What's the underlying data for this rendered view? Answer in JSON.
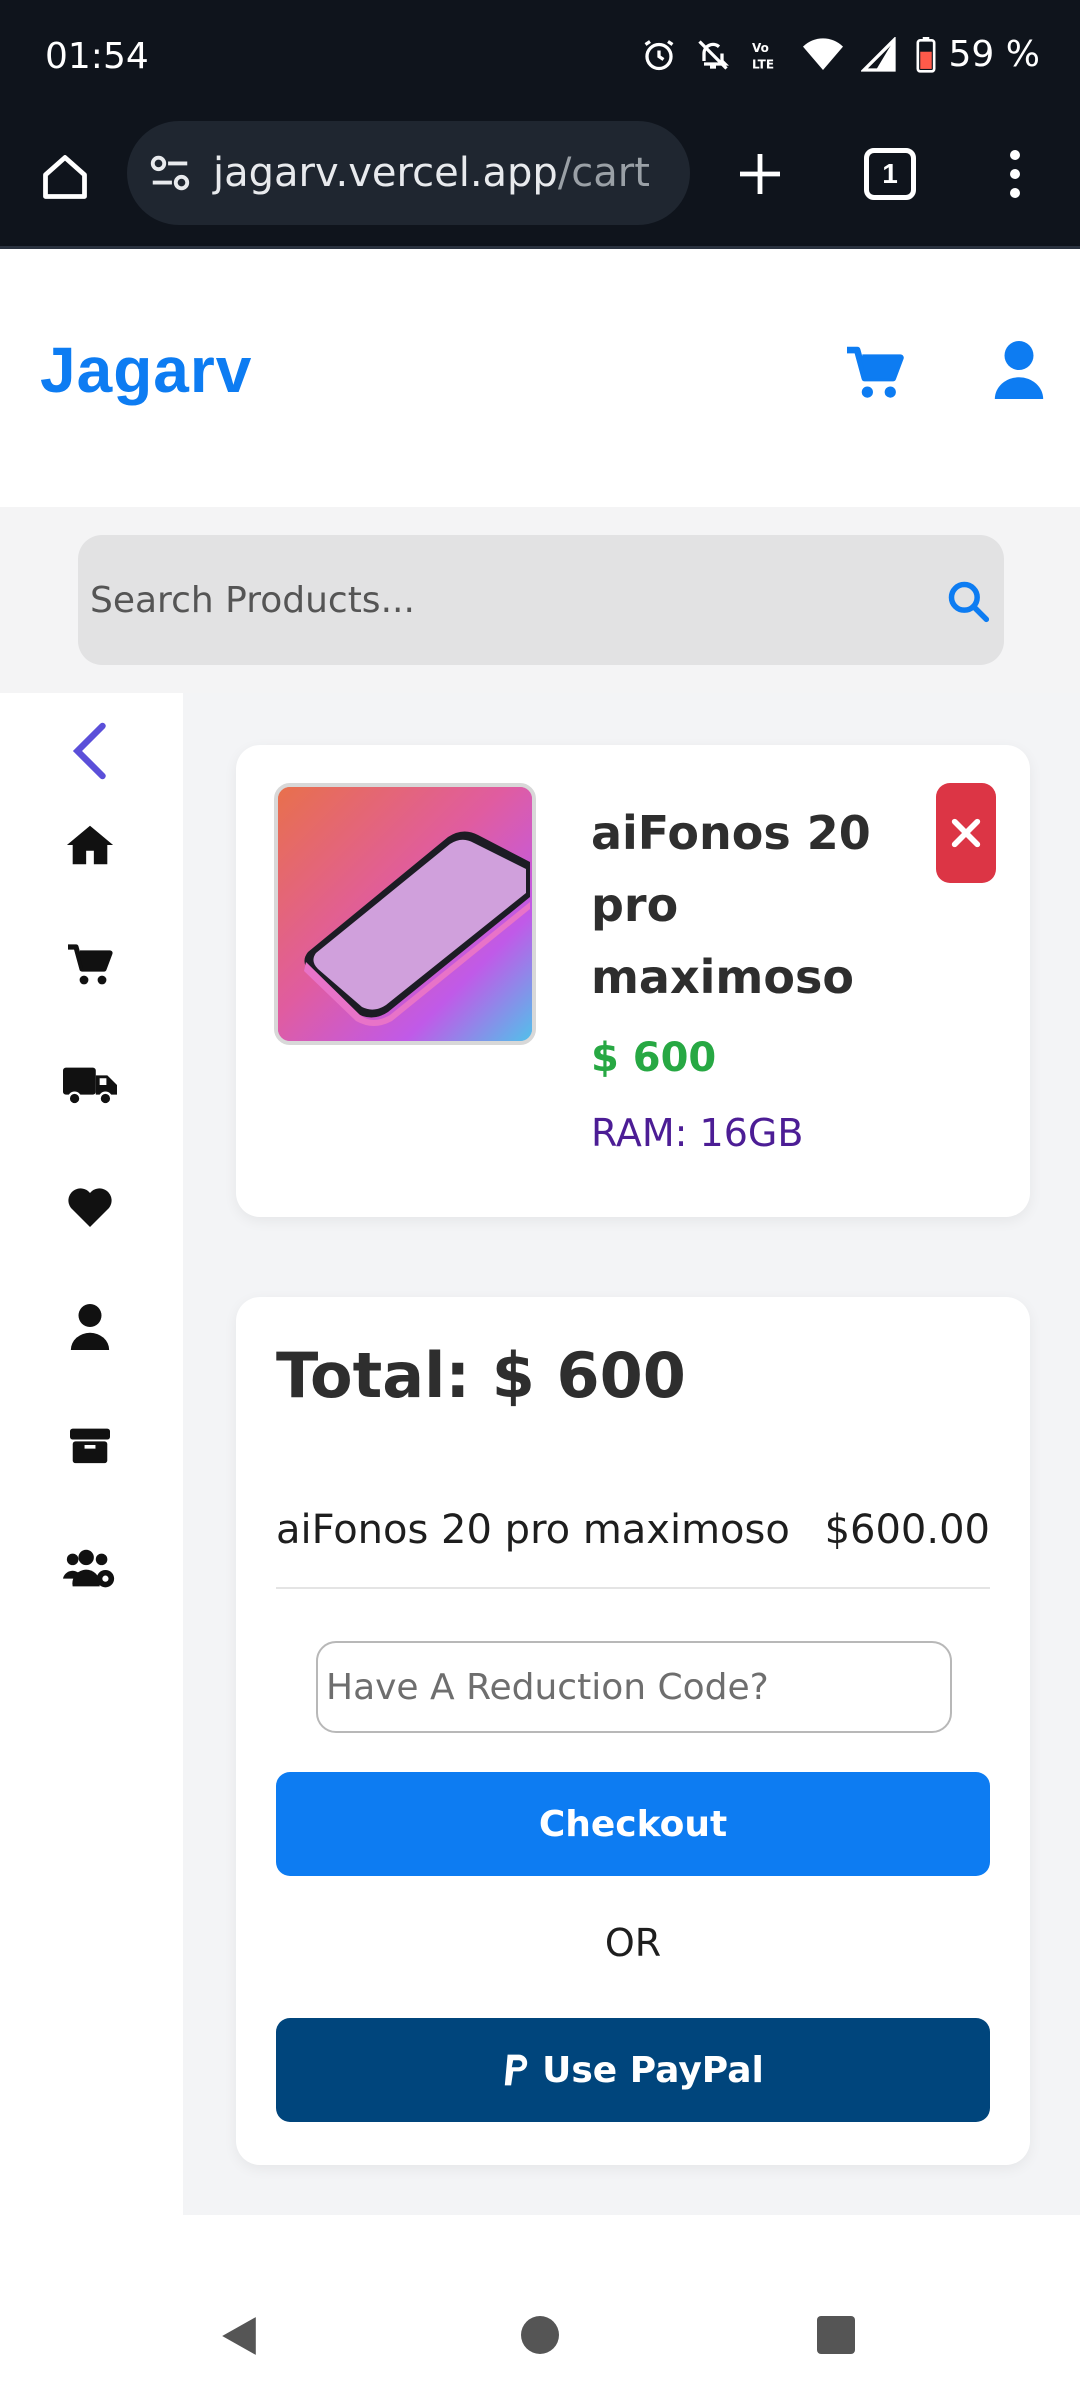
{
  "status_bar": {
    "time": "01:54",
    "battery": "59 %",
    "icons": [
      "alarm-icon",
      "mute-icon",
      "volte-icon",
      "wifi-icon",
      "signal-icon",
      "battery-icon"
    ]
  },
  "browser": {
    "url_host": "jagarv.vercel.app",
    "url_path": "/cart",
    "tab_count": "1"
  },
  "header": {
    "logo": "Jagarv",
    "brand_color": "#0d7cf2"
  },
  "search": {
    "placeholder": "Search Products..."
  },
  "sidebar": {
    "items": [
      {
        "icon": "back-chevron-icon"
      },
      {
        "icon": "home-icon"
      },
      {
        "icon": "cart-icon"
      },
      {
        "icon": "truck-icon"
      },
      {
        "icon": "heart-icon"
      },
      {
        "icon": "user-icon"
      },
      {
        "icon": "box-icon"
      },
      {
        "icon": "users-gear-icon"
      }
    ]
  },
  "cart_item": {
    "name": "aiFonos 20 pro maximoso",
    "price": "$ 600",
    "ram": "RAM: 16GB"
  },
  "summary": {
    "total": "Total: $ 600",
    "line_name": "aiFonos 20 pro maximoso",
    "line_price": "$600.00",
    "code_placeholder": "Have A Reduction Code?",
    "checkout_label": "Checkout",
    "or_text": "OR",
    "paypal_label": "Use PayPal",
    "colors": {
      "checkout": "#0d7cf2",
      "paypal": "#00457c",
      "price": "#27a843",
      "remove": "#dc3545"
    }
  }
}
